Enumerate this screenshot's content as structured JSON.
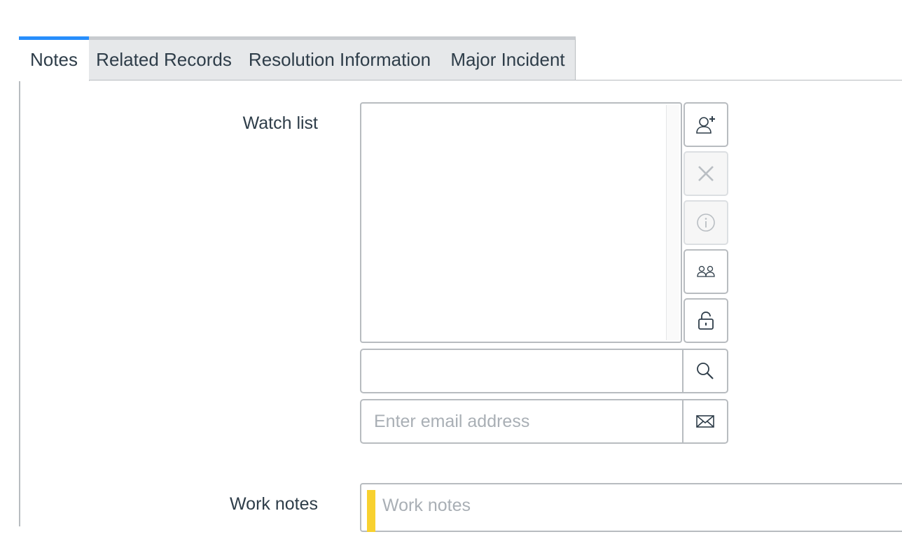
{
  "tabs": [
    {
      "label": "Notes",
      "active": true
    },
    {
      "label": "Related Records",
      "active": false
    },
    {
      "label": "Resolution Information",
      "active": false
    },
    {
      "label": "Major Incident",
      "active": false
    }
  ],
  "watch_list": {
    "label": "Watch list",
    "buttons": [
      {
        "icon": "add-user-icon",
        "enabled": true
      },
      {
        "icon": "close-icon",
        "enabled": false
      },
      {
        "icon": "info-icon",
        "enabled": false
      },
      {
        "icon": "group-icon",
        "enabled": true
      },
      {
        "icon": "unlock-icon",
        "enabled": true
      }
    ],
    "search": {
      "value": "",
      "placeholder": "",
      "icon": "search-icon"
    },
    "email": {
      "value": "",
      "placeholder": "Enter email address",
      "icon": "envelope-icon"
    }
  },
  "work_notes": {
    "label": "Work notes",
    "placeholder": "Work notes",
    "flag_color": "#f8d12f"
  },
  "colors": {
    "accent": "#278efc",
    "border": "#b8bcc0",
    "text": "#2e3d49"
  }
}
